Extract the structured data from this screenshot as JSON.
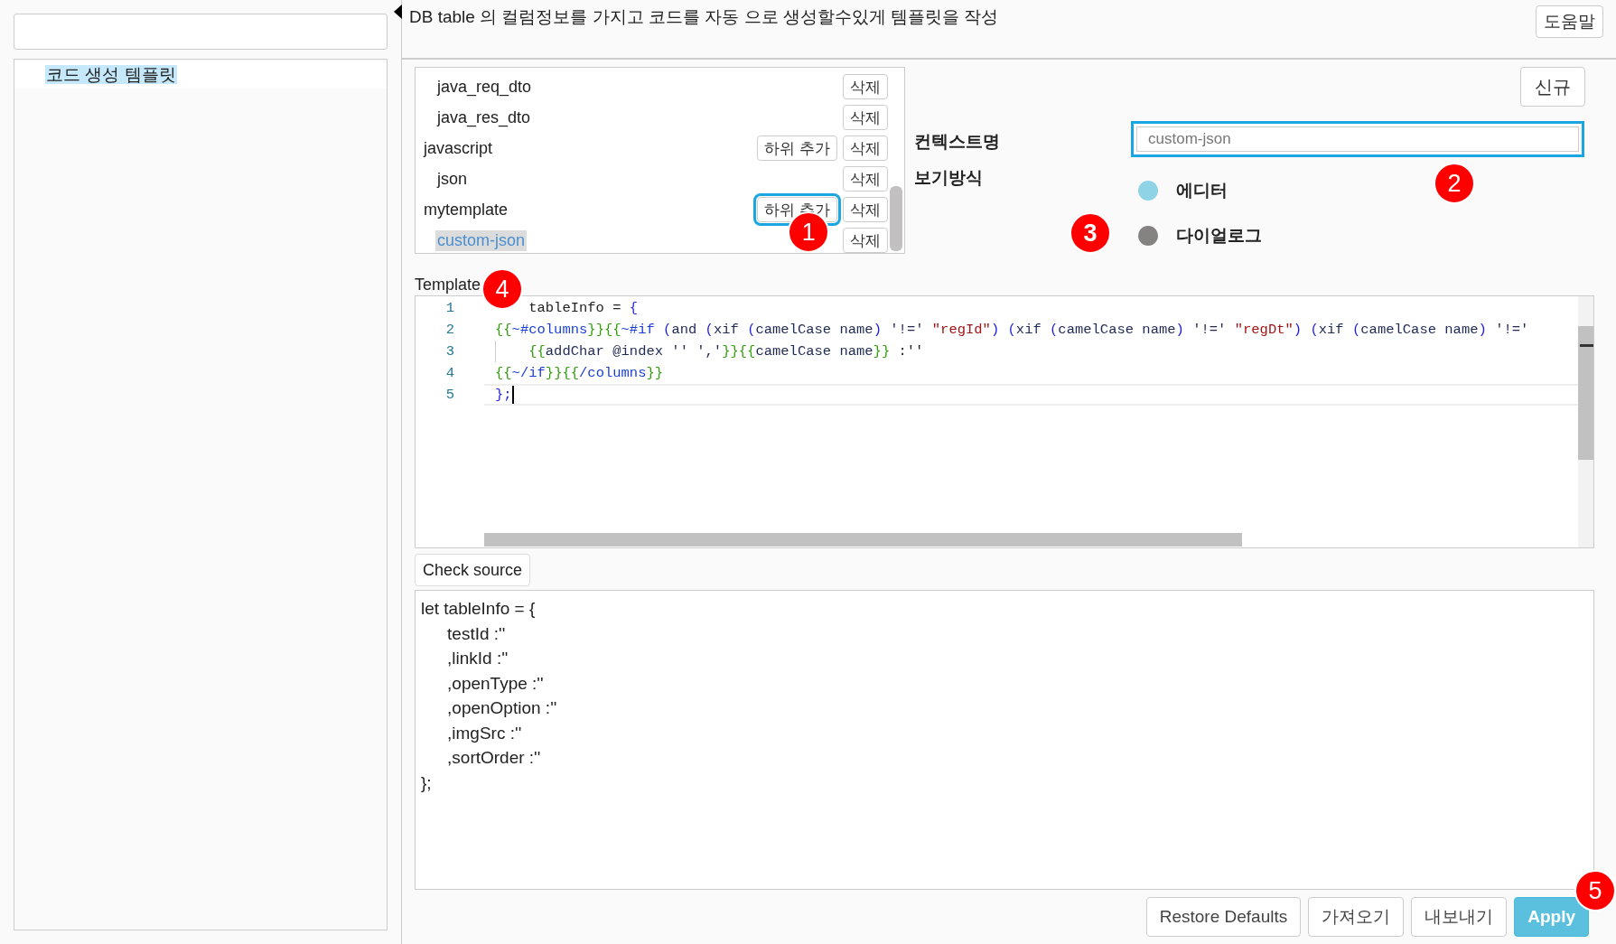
{
  "sidebar": {
    "tree": [
      {
        "label": "코드 생성 템플릿",
        "selected": true
      }
    ]
  },
  "header": {
    "title": "DB table 의 컬럼정보를 가지고 코드를 자동 으로 생성할수있게 템플릿을 작성",
    "help_button": "도움말"
  },
  "template_list": {
    "items": [
      {
        "children": [
          {
            "label": "java_req_dto",
            "selected": false,
            "delete_button": "삭제"
          },
          {
            "label": "java_res_dto",
            "selected": false,
            "delete_button": "삭제"
          }
        ]
      },
      {
        "label": "javascript",
        "selected": false,
        "add_child_button": {
          "label": "하위 추가",
          "highlighted": false
        },
        "delete_button": "삭제",
        "children": [
          {
            "label": "json",
            "selected": false,
            "delete_button": "삭제"
          }
        ]
      },
      {
        "label": "mytemplate",
        "selected": false,
        "add_child_button": {
          "label": "하위 추가",
          "highlighted": true,
          "badge": "1"
        },
        "delete_button": "삭제",
        "children": [
          {
            "label": "custom-json",
            "selected": true,
            "delete_button": "삭제"
          }
        ]
      }
    ]
  },
  "form": {
    "new_button": "신규",
    "context_name": {
      "label": "컨텍스트명",
      "placeholder": "custom-json",
      "highlighted": true,
      "badge": "2"
    },
    "view_mode": {
      "label": "보기방식",
      "options": [
        {
          "label": "에디터",
          "selected": true
        },
        {
          "label": "다이얼로그",
          "selected": false,
          "badge": "3"
        }
      ]
    }
  },
  "template": {
    "label": "Template",
    "badge": "4",
    "line_numbers": [
      "1",
      "2",
      "3",
      "4",
      "5"
    ],
    "lines": [
      [
        {
          "text": "    tableInfo = ",
          "kind": "plain"
        },
        {
          "text": "{",
          "kind": "paren"
        }
      ],
      [
        {
          "text": "{{",
          "kind": "brace"
        },
        {
          "text": "~#columns",
          "kind": "hash"
        },
        {
          "text": "}}{{",
          "kind": "brace"
        },
        {
          "text": "~#if ",
          "kind": "hash"
        },
        {
          "text": "(",
          "kind": "paren"
        },
        {
          "text": "and ",
          "kind": "ident"
        },
        {
          "text": "(",
          "kind": "paren"
        },
        {
          "text": "xif ",
          "kind": "ident"
        },
        {
          "text": "(",
          "kind": "paren"
        },
        {
          "text": "camelCase name",
          "kind": "ident"
        },
        {
          "text": ") ",
          "kind": "paren"
        },
        {
          "text": "'!=' ",
          "kind": "ident"
        },
        {
          "text": "\"regId\"",
          "kind": "string"
        },
        {
          "text": ") (",
          "kind": "paren"
        },
        {
          "text": "xif ",
          "kind": "ident"
        },
        {
          "text": "(",
          "kind": "paren"
        },
        {
          "text": "camelCase name",
          "kind": "ident"
        },
        {
          "text": ") ",
          "kind": "paren"
        },
        {
          "text": "'!=' ",
          "kind": "ident"
        },
        {
          "text": "\"regDt\"",
          "kind": "string"
        },
        {
          "text": ") (",
          "kind": "paren"
        },
        {
          "text": "xif ",
          "kind": "ident"
        },
        {
          "text": "(",
          "kind": "paren"
        },
        {
          "text": "camelCase name",
          "kind": "ident"
        },
        {
          "text": ") ",
          "kind": "paren"
        },
        {
          "text": "'!='",
          "kind": "ident"
        }
      ],
      [
        {
          "text": "    {{",
          "kind": "brace"
        },
        {
          "text": "addChar @index '' ','",
          "kind": "ident"
        },
        {
          "text": "}}{{",
          "kind": "brace"
        },
        {
          "text": "camelCase name",
          "kind": "ident"
        },
        {
          "text": "}}",
          "kind": "brace"
        },
        {
          "text": " :''",
          "kind": "plain"
        }
      ],
      [
        {
          "text": "{{",
          "kind": "brace"
        },
        {
          "text": "~/if",
          "kind": "hash"
        },
        {
          "text": "}}{{",
          "kind": "brace"
        },
        {
          "text": "/columns",
          "kind": "hash"
        },
        {
          "text": "}}",
          "kind": "brace"
        }
      ],
      [
        {
          "text": "};",
          "kind": "paren"
        }
      ]
    ]
  },
  "check_source_button": "Check source",
  "output": {
    "lines": [
      "let tableInfo = {",
      "\ttestId :''",
      "\t,linkId :''",
      "\t,openType :''",
      "\t,openOption :''",
      "\t,imgSrc :''",
      "\t,sortOrder :''",
      "};"
    ]
  },
  "buttons": [
    {
      "label": "Restore Defaults",
      "kind": "default"
    },
    {
      "label": "가져오기",
      "kind": "default"
    },
    {
      "label": "내보내기",
      "kind": "default"
    },
    {
      "label": "Apply",
      "kind": "primary",
      "badge": "5"
    }
  ]
}
